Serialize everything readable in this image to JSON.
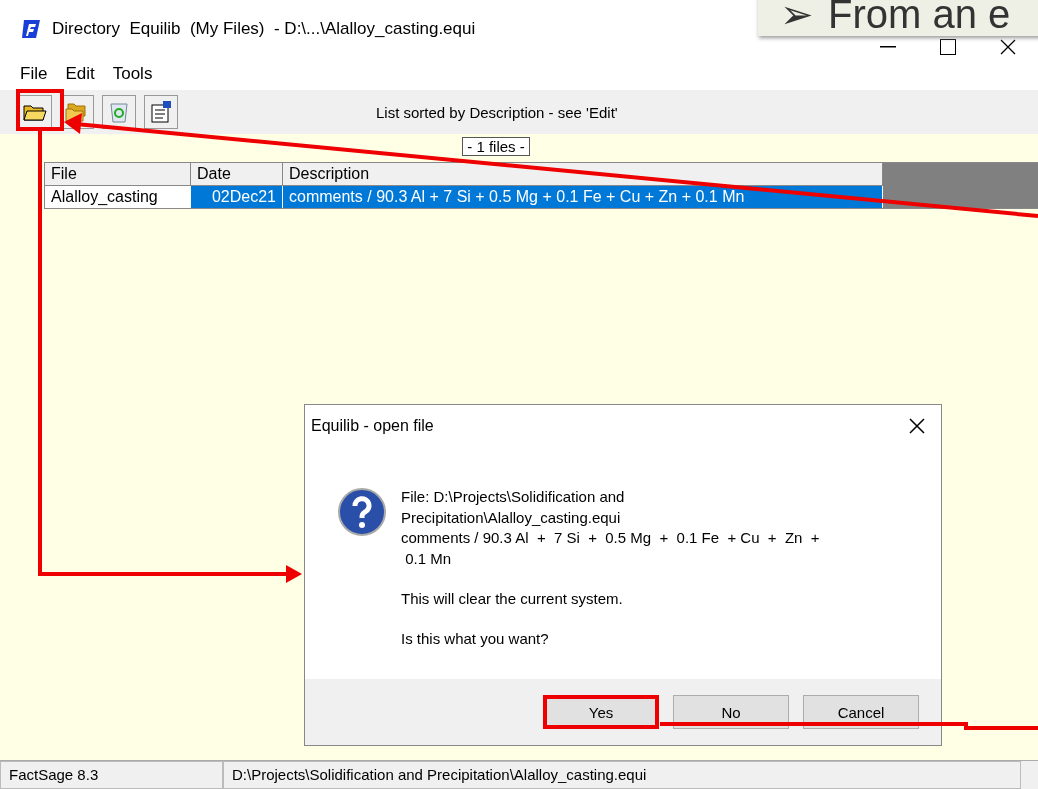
{
  "window": {
    "title": "Directory  Equilib  (My Files)  - D:\\...\\Alalloy_casting.equi"
  },
  "callout": {
    "bullet": "➢",
    "text": "From an e"
  },
  "menu": [
    "File",
    "Edit",
    "Tools"
  ],
  "toolbar": {
    "sort_note": "List sorted by Description - see 'Edit'",
    "count": "- 1 files -"
  },
  "table": {
    "columns": [
      "File",
      "Date",
      "Description"
    ],
    "rows": [
      {
        "file": "Alalloy_casting",
        "date": "02Dec21",
        "description": "comments / 90.3 Al  +  7 Si  +  0.5 Mg  +  0.1 Fe  + Cu  +  Zn  +  0.1 Mn",
        "selected": true
      }
    ]
  },
  "dialog": {
    "title": "Equilib - open file",
    "lines": [
      "File: D:\\Projects\\Solidification and",
      "Precipitation\\Alalloy_casting.equi",
      "comments / 90.3 Al  +  7 Si  +  0.5 Mg  +  0.1 Fe  + Cu  +  Zn  +",
      " 0.1 Mn"
    ],
    "warning": "This will clear the current system.",
    "question": "Is this what you want?",
    "buttons": [
      {
        "label": "Yes",
        "highlighted": true
      },
      {
        "label": "No",
        "highlighted": false
      },
      {
        "label": "Cancel",
        "highlighted": false
      }
    ]
  },
  "status_bar": [
    "FactSage 8.3",
    "D:\\Projects\\Solidification and Precipitation\\Alalloy_casting.equi"
  ]
}
